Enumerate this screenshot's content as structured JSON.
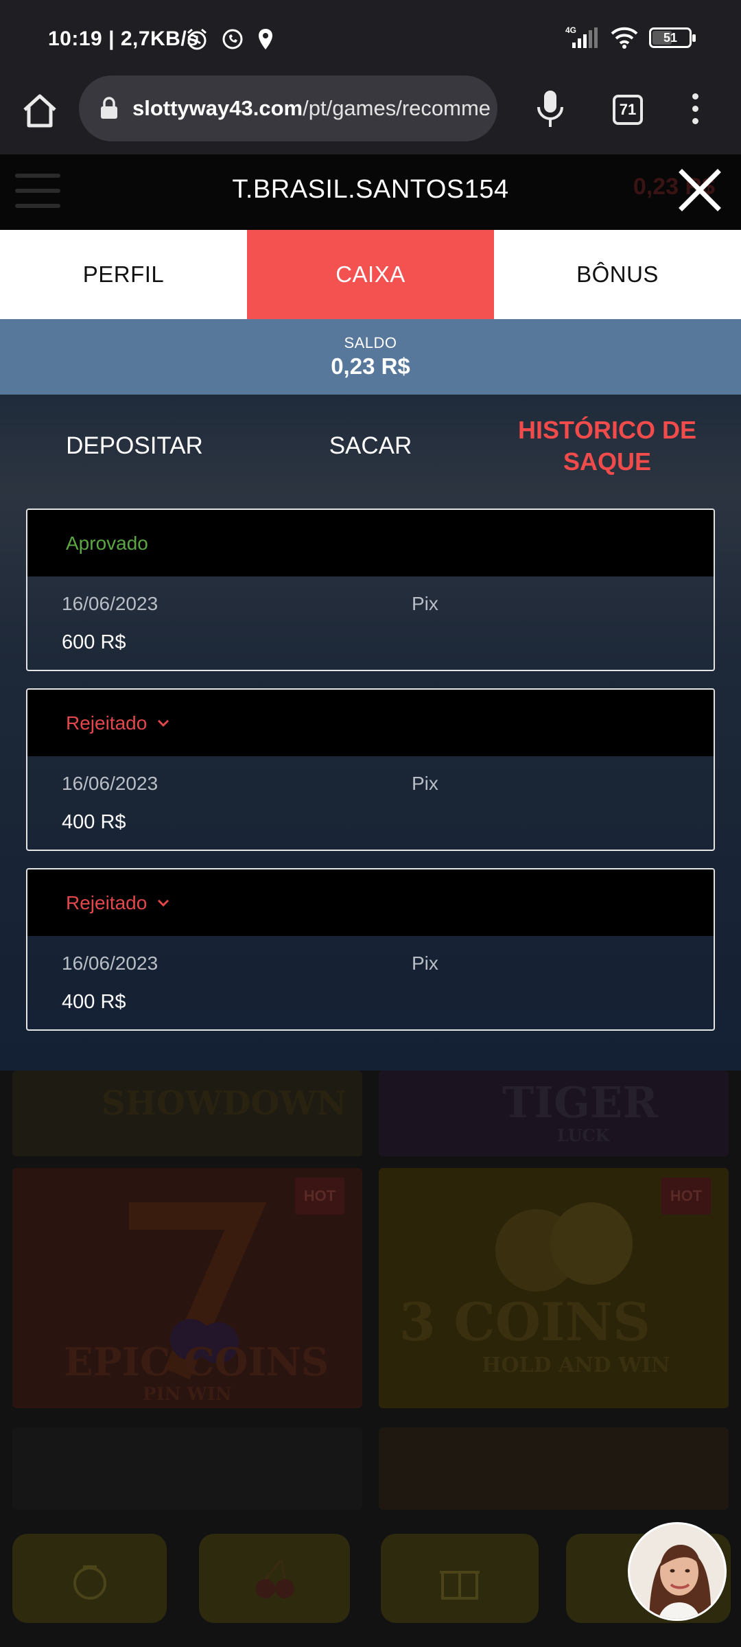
{
  "status_bar": {
    "time": "10:19",
    "speed": "2,7KB/s",
    "network": "4G",
    "battery": "51"
  },
  "browser": {
    "url_domain": "slottyway43.com",
    "url_path": "/pt/games/recomme",
    "tab_count": "71"
  },
  "modal": {
    "title": "T.BRASIL.SANTOS154",
    "bg_amount": "0,23 R$"
  },
  "main_tabs": [
    {
      "label": "PERFIL",
      "active": false
    },
    {
      "label": "CAIXA",
      "active": true
    },
    {
      "label": "BÔNUS",
      "active": false
    }
  ],
  "balance": {
    "label": "SALDO",
    "value": "0,23 R$"
  },
  "sub_tabs": [
    {
      "label": "DEPOSITAR"
    },
    {
      "label": "SACAR"
    },
    {
      "label": "HISTÓRICO DE SAQUE",
      "active": true
    }
  ],
  "withdrawals": [
    {
      "status": "Aprovado",
      "date": "16/06/2023",
      "method": "Pix",
      "amount": "600 R$"
    },
    {
      "status": "Rejeitado",
      "date": "16/06/2023",
      "method": "Pix",
      "amount": "400 R$"
    },
    {
      "status": "Rejeitado",
      "date": "16/06/2023",
      "method": "Pix",
      "amount": "400 R$"
    }
  ],
  "background_games": {
    "showdown": "SHOWDOWN",
    "tiger": "TIGER",
    "tiger_sub": "LUCK",
    "epic_coins": "EPIC COINS",
    "epic_sub": "PIN WIN",
    "coins_3": "3 COINS",
    "coins_sub": "HOLD AND WIN",
    "hot_badge": "HOT"
  },
  "colors": {
    "accent": "#f45151",
    "balance_bg": "#57779b",
    "approved": "#5aa744",
    "rejected": "#e2474b"
  }
}
